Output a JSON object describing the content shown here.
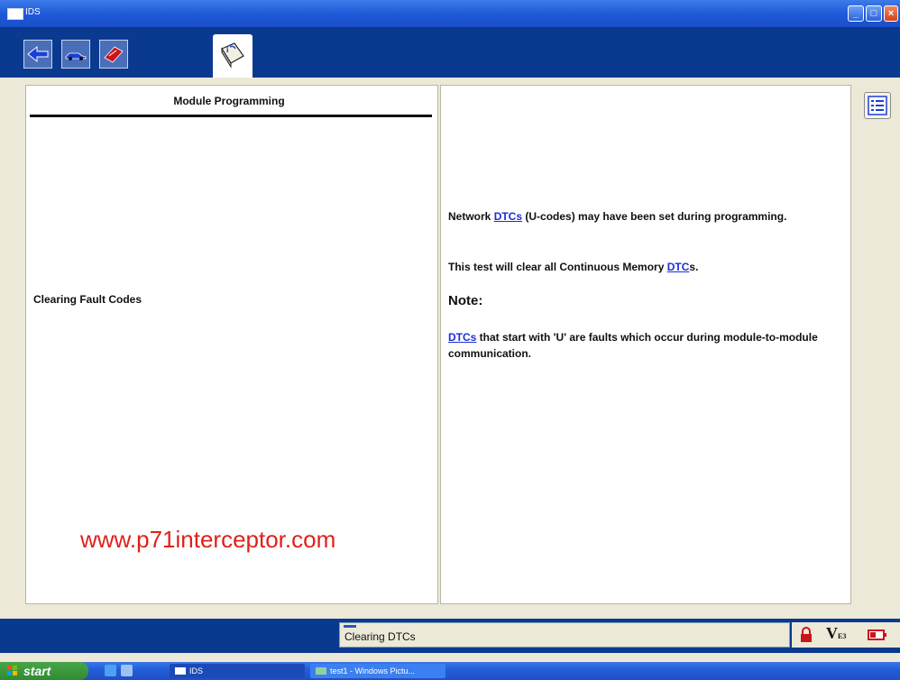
{
  "window": {
    "title": "IDS"
  },
  "toolbar": {
    "buttons": [
      {
        "icon": "connection-arrow-icon"
      },
      {
        "icon": "vehicle-icon"
      },
      {
        "icon": "toolbox-icon"
      },
      {
        "icon": "module-programming-icon",
        "active": true
      }
    ]
  },
  "left_panel": {
    "heading": "Module Programming",
    "step": "Clearing Fault Codes",
    "watermark": "www.p71interceptor.com"
  },
  "right_panel": {
    "p1": {
      "a": "Network ",
      "link": "DTCs",
      "b": " (U-codes) may have been set during programming."
    },
    "p2": {
      "a": "This test will clear all Continuous Memory ",
      "link": "DTC",
      "b": "s."
    },
    "note": "Note:",
    "p3": {
      "link": "DTCs",
      "b": " that start with 'U' are faults which occur during module-to-module communication."
    }
  },
  "statusbar": {
    "status_text": "Clearing DTCs",
    "volt_label": "V",
    "volt_sub": "E3"
  },
  "taskbar": {
    "start": "start",
    "tasks": [
      "IDS",
      "test1 - Windows Pictu..."
    ]
  },
  "colors": {
    "link": "#1a2fd6",
    "watermark": "#e0211a",
    "toolbar": "#0a3a8f"
  }
}
